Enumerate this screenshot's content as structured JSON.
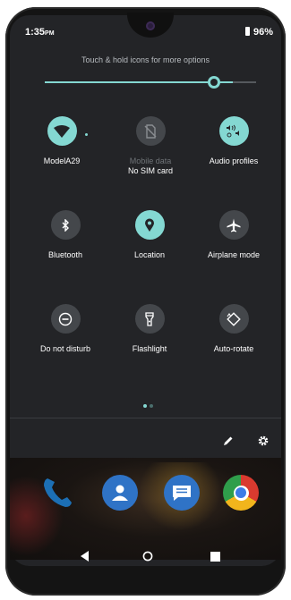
{
  "status_bar": {
    "time": "1:35",
    "time_suffix": "PM",
    "battery": "96%"
  },
  "quick_settings": {
    "hint": "Touch & hold icons for more options",
    "brightness_level": 0.89,
    "tiles": [
      {
        "name": "wifi",
        "label": "ModelA29",
        "sub": "",
        "active": true,
        "icon": "wifi-icon"
      },
      {
        "name": "mobile-data",
        "label": "Mobile data",
        "sub": "No SIM card",
        "active": false,
        "icon": "no-sim-icon"
      },
      {
        "name": "audio-profiles",
        "label": "Audio profiles",
        "sub": "",
        "active": true,
        "icon": "audio-profiles-icon"
      },
      {
        "name": "bluetooth",
        "label": "Bluetooth",
        "sub": "",
        "active": false,
        "icon": "bluetooth-icon"
      },
      {
        "name": "location",
        "label": "Location",
        "sub": "",
        "active": true,
        "icon": "location-icon"
      },
      {
        "name": "airplane-mode",
        "label": "Airplane mode",
        "sub": "",
        "active": false,
        "icon": "airplane-icon"
      },
      {
        "name": "do-not-disturb",
        "label": "Do not disturb",
        "sub": "",
        "active": false,
        "icon": "do-not-disturb-icon"
      },
      {
        "name": "flashlight",
        "label": "Flashlight",
        "sub": "",
        "active": false,
        "icon": "flashlight-icon"
      },
      {
        "name": "auto-rotate",
        "label": "Auto-rotate",
        "sub": "",
        "active": false,
        "icon": "auto-rotate-icon"
      }
    ],
    "page_indicator": {
      "current": 1,
      "total": 2
    }
  },
  "colors": {
    "accent": "#84d8d2",
    "tile_off": "#44474b",
    "panel": "#232427"
  },
  "footer_icons": [
    "edit-icon",
    "settings-gear-icon"
  ],
  "dock_apps": [
    "phone-app-icon",
    "contacts-app-icon",
    "messages-app-icon",
    "chrome-app-icon"
  ],
  "nav_bar": [
    "back-icon",
    "home-icon",
    "recents-icon"
  ]
}
